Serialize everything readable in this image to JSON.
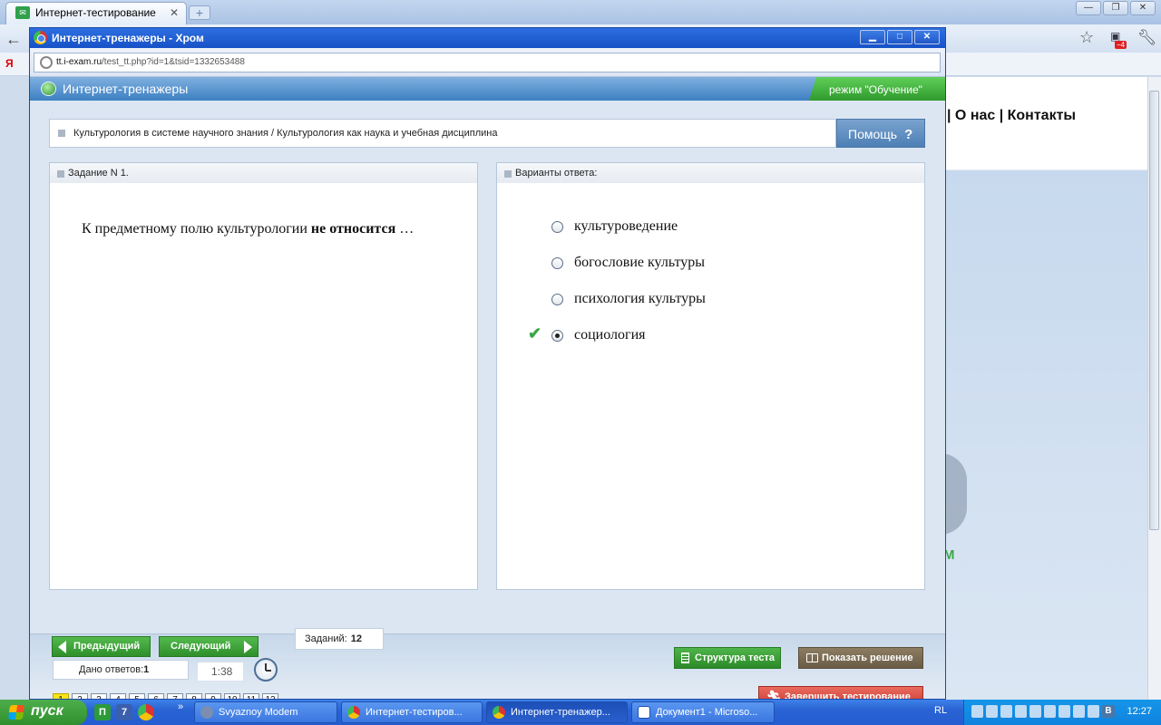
{
  "background_window": {
    "tab_title": "Интернет-тестирование",
    "site_links": "| О нас | Контакты",
    "brand_fragment": "M",
    "bookmark_ya": "Я",
    "ext_badge": "4"
  },
  "popup": {
    "title": "Интернет-тренажеры - Хром",
    "url_host": "tt.i-exam.ru",
    "url_path": "/test_tt.php?id=1&tsid=1332653488"
  },
  "app": {
    "title": "Интернет-тренажеры",
    "mode": "режим \"Обучение\"",
    "topic": "Культурология в системе научного знания / Культурология как наука и учебная дисциплина",
    "help_label": "Помощь",
    "help_glyph": "?",
    "task_header": "Задание N 1.",
    "answers_header": "Варианты ответа:",
    "question": {
      "part1": "К предметному полю культурологии ",
      "part2": "не относится",
      "part3": " …"
    },
    "options": [
      {
        "label": "культуроведение",
        "selected": false
      },
      {
        "label": "богословие культуры",
        "selected": false
      },
      {
        "label": "психология культуры",
        "selected": false
      },
      {
        "label": "социология",
        "selected": true,
        "correct": true
      }
    ],
    "nav": {
      "prev_label": "Предыдущий",
      "next_label": "Следующий",
      "answered_label": "Дано ответов:",
      "answered_count": "1",
      "timer": "1:38",
      "tasks_label": "Заданий:",
      "tasks_count": "12",
      "structure_label": "Структура теста",
      "solution_label": "Показать решение",
      "finish_label": "Завершить тестирование",
      "task_numbers": [
        "1",
        "2",
        "3",
        "4",
        "5",
        "6",
        "7",
        "8",
        "9",
        "10",
        "11",
        "12"
      ],
      "current_task": "1"
    }
  },
  "taskbar": {
    "start_label": "пуск",
    "more_glyph": "»",
    "buttons": [
      {
        "label": "Svyaznoy Modem"
      },
      {
        "label": "Интернет-тестиров..."
      },
      {
        "label": "Интернет-тренажер..."
      },
      {
        "label": "Документ1 - Microso..."
      }
    ],
    "lang": "RL",
    "vk": "B",
    "time": "12:27"
  },
  "colors": {
    "accent_green": "#2f9a2c",
    "header_blue": "#3d7fc2",
    "finish_red": "#c8372d",
    "current_task_yellow": "#f7e51a"
  }
}
